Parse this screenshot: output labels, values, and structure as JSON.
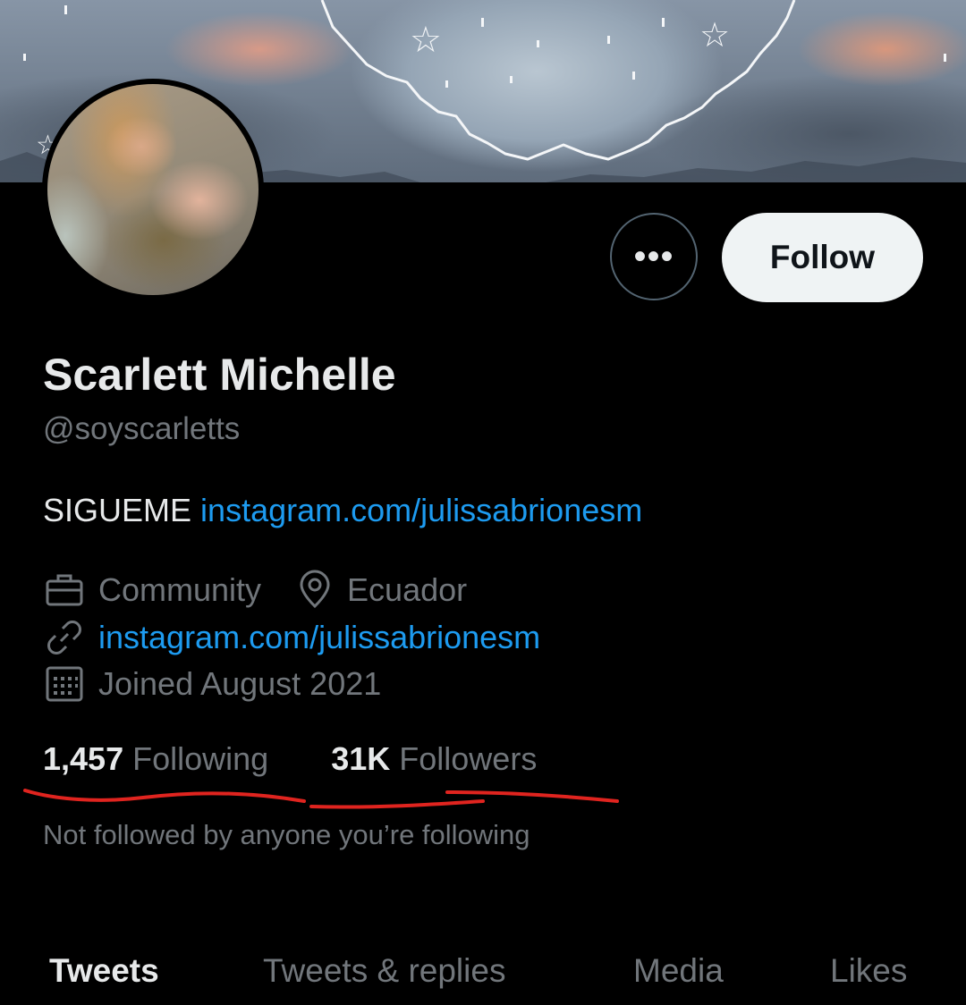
{
  "profile": {
    "name": "Scarlett Michelle",
    "handle": "@soyscarletts",
    "bio_text": "SIGUEME",
    "bio_link": "instagram.com/julissabrionesm",
    "category": "Community",
    "location": "Ecuador",
    "website": "instagram.com/julissabrionesm",
    "joined": "Joined August 2021",
    "following_count": "1,457",
    "following_label": "Following",
    "followers_count": "31K",
    "followers_label": "Followers",
    "followed_by_note": "Not followed by anyone you’re following"
  },
  "actions": {
    "more_label": "•••",
    "follow_label": "Follow"
  },
  "tabs": [
    {
      "label": "Tweets",
      "active": true
    },
    {
      "label": "Tweets & replies",
      "active": false
    },
    {
      "label": "Media",
      "active": false
    },
    {
      "label": "Likes",
      "active": false
    }
  ],
  "icons": {
    "category": "briefcase-icon",
    "location": "location-pin-icon",
    "website": "link-icon",
    "joined": "calendar-icon"
  },
  "colors": {
    "background": "#000000",
    "primary_text": "#e7e9ea",
    "secondary_text": "#71767b",
    "link": "#1d9bf0",
    "follow_button_bg": "#eff3f4",
    "annotation_underline": "#e0241f"
  }
}
